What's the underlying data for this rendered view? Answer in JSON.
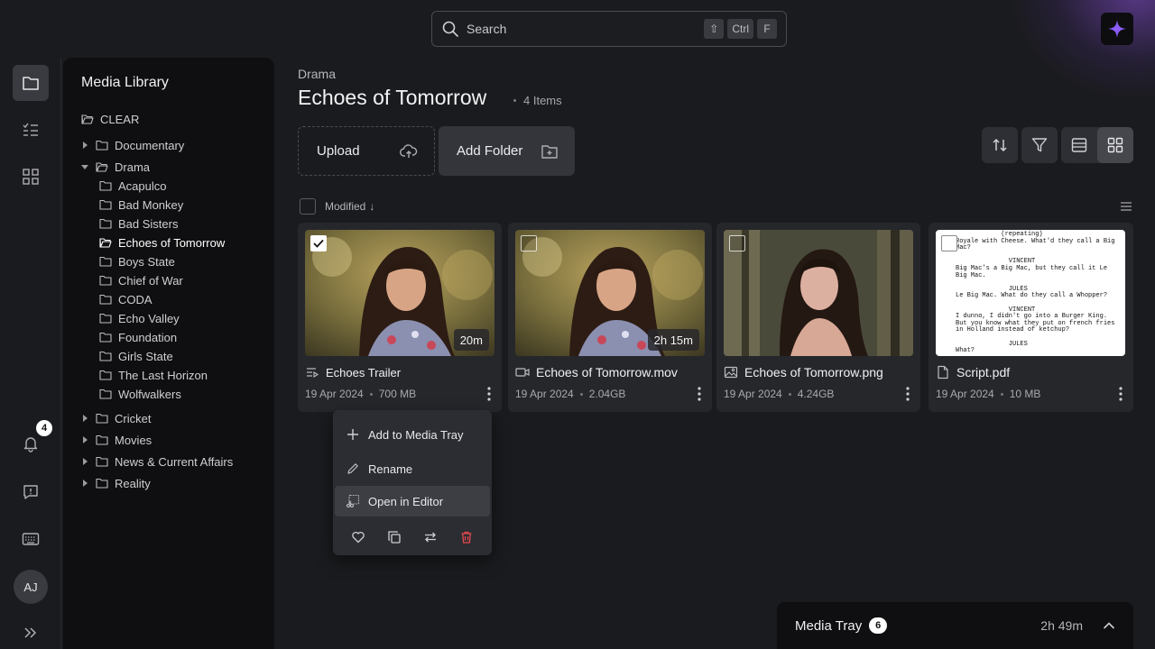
{
  "search": {
    "placeholder": "Search",
    "keys": [
      "⇧",
      "Ctrl",
      "F"
    ]
  },
  "rail": {
    "notification_count": "4",
    "avatar_initials": "AJ"
  },
  "library": {
    "title": "Media Library",
    "root": "CLEAR",
    "tree": [
      {
        "label": "Documentary",
        "level": 1,
        "expanded": false
      },
      {
        "label": "Drama",
        "level": 1,
        "expanded": true
      },
      {
        "label": "Acapulco",
        "level": 2
      },
      {
        "label": "Bad Monkey",
        "level": 2
      },
      {
        "label": "Bad Sisters",
        "level": 2
      },
      {
        "label": "Echoes of Tomorrow",
        "level": 2,
        "selected": true
      },
      {
        "label": "Boys State",
        "level": 2
      },
      {
        "label": "Chief of War",
        "level": 2
      },
      {
        "label": "CODA",
        "level": 2
      },
      {
        "label": "Echo Valley",
        "level": 2
      },
      {
        "label": "Foundation",
        "level": 2
      },
      {
        "label": "Girls State",
        "level": 2
      },
      {
        "label": "The Last Horizon",
        "level": 2
      },
      {
        "label": "Wolfwalkers",
        "level": 2
      },
      {
        "label": "Cricket",
        "level": 1,
        "expanded": false
      },
      {
        "label": "Movies",
        "level": 1,
        "expanded": false
      },
      {
        "label": "News & Current Affairs",
        "level": 1,
        "expanded": false
      },
      {
        "label": "Reality",
        "level": 1,
        "expanded": false
      }
    ]
  },
  "main": {
    "breadcrumb": "Drama",
    "title": "Echoes of Tomorrow",
    "items_count": "4 Items",
    "upload_label": "Upload",
    "add_folder_label": "Add Folder",
    "sort_label": "Modified",
    "sort_direction": "↓"
  },
  "cards": [
    {
      "name": "Echoes Trailer",
      "type": "sequence",
      "date": "19 Apr 2024",
      "size": "700 MB",
      "duration": "20m",
      "checked": true
    },
    {
      "name": "Echoes of Tomorrow.mov",
      "type": "video",
      "date": "19 Apr 2024",
      "size": "2.04GB",
      "duration": "2h 15m",
      "checked": false
    },
    {
      "name": "Echoes of Tomorrow.png",
      "type": "image",
      "date": "19 Apr 2024",
      "size": "4.24GB",
      "checked": false
    },
    {
      "name": "Script.pdf",
      "type": "pdf",
      "date": "19 Apr 2024",
      "size": "10 MB",
      "checked": false,
      "preview_text": "            (repeating)\nRoyale with Cheese. What'd they call a Big\nMac?\n\n              VINCENT\nBig Mac's a Big Mac, but they call it Le\nBig Mac.\n\n              JULES\nLe Big Mac. What do they call a Whopper?\n\n              VINCENT\nI dunno, I didn't go into a Burger King.\nBut you know what they put on french fries\nin Holland instead of ketchup?\n\n              JULES\nWhat?"
    }
  ],
  "context_menu": {
    "items": [
      "Add to Media Tray",
      "Rename",
      "Open in Editor"
    ],
    "hovered": "Open in Editor"
  },
  "media_tray": {
    "title": "Media Tray",
    "count": "6",
    "duration": "2h 49m"
  },
  "colors": {
    "accent": "#7c3aed",
    "danger": "#e5484d",
    "background": "#1a1b1e",
    "panel": "#0f0f11"
  }
}
